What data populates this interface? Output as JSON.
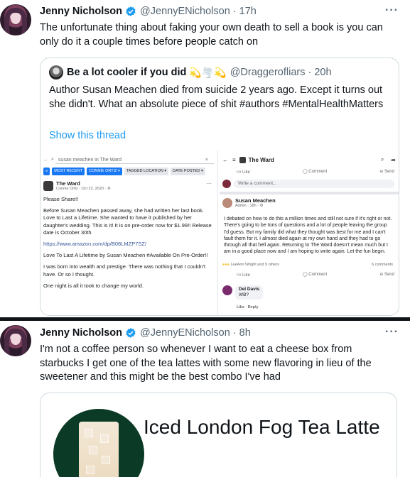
{
  "tweet1": {
    "name": "Jenny Nicholson",
    "handle": "@JennyENicholson",
    "dot": "·",
    "time": "17h",
    "more": "···",
    "text": "The unfortunate thing about faking your own death to sell a book is you can only do it a couple times before people catch on",
    "quote": {
      "name": "Be a lot cooler if you did",
      "emoji": "💫🌪️💫",
      "handle": "@Draggerofliars",
      "dot": "·",
      "time": "20h",
      "text": "Author Susan Meachen died from suicide 2 years ago. Except it turns out she didn't. What an absolute piece of shit #authors #MentalHealthMatters",
      "show_thread": "Show this thread",
      "media": {
        "left": {
          "search": "susan meachen in The Ward",
          "chips": [
            "MOST RECENT",
            "CONNIE ORTIZ ▾",
            "TAGGED LOCATION ▾",
            "DATE POSTED ▾"
          ],
          "group": "The Ward",
          "author_line": "Connie Ortiz · Oct 22, 2020 · ⚙",
          "paragraphs": [
            "Please Share!!",
            "Before Susan Meachen passed away, she had written her last book. Love to Last a Lifetime. She wanted to have it published by her daughter's wedding. This is it! It is on pre-order now for $1.99!! Release date is October 30th",
            "https://www.amazon.com/dp/B08LMZP7SZ/",
            "Love To Last A Lifetime by Susan Meachen #Available On Pre-Order!!",
            "I was born into wealth and prestige. There was nothing that I couldn't have. Or so I thought.",
            "One night is all it took to change my world."
          ]
        },
        "right": {
          "title": "The Ward",
          "actions": [
            "Like",
            "Comment",
            "Send"
          ],
          "write_placeholder": "Write a comment...",
          "poster": "Susan Meachen",
          "poster_sub": "Admin · 18h · ⚙",
          "body": "I debated on how to do this a million times and still not sure if it's right or not. There's going to be tons of questions and a lot of people leaving the group I'd guess. But my family did what they thought was best for me and I can't fault them for it. I almost died again at my own hand and they had to go through all that hell again. Returning to The Ward doesn't mean much but I am in a good place now and I am hoping to write again. Let the fun begin.",
          "reactions": "LeeAnn Wright and 9 others",
          "comments_count": "6 comments",
          "commenter": "Del Davis",
          "comment": "WB?",
          "comment_actions": "Like   Reply"
        }
      }
    }
  },
  "tweet2": {
    "name": "Jenny Nicholson",
    "handle": "@JennyENicholson",
    "dot": "·",
    "time": "8h",
    "more": "···",
    "text": "I'm not a coffee person so whenever I want to eat a cheese box from starbucks I get one of the tea lattes with some new flavoring in lieu of the sweetener and this might be the best combo I've had",
    "card_title": "Iced London Fog Tea Latte"
  },
  "colors": {
    "verified": "#1d9bf0",
    "link": "#1d9bf0",
    "secondary_text": "#536471",
    "facebook_blue": "#1877f2",
    "starbucks_green": "#0b3a26"
  }
}
